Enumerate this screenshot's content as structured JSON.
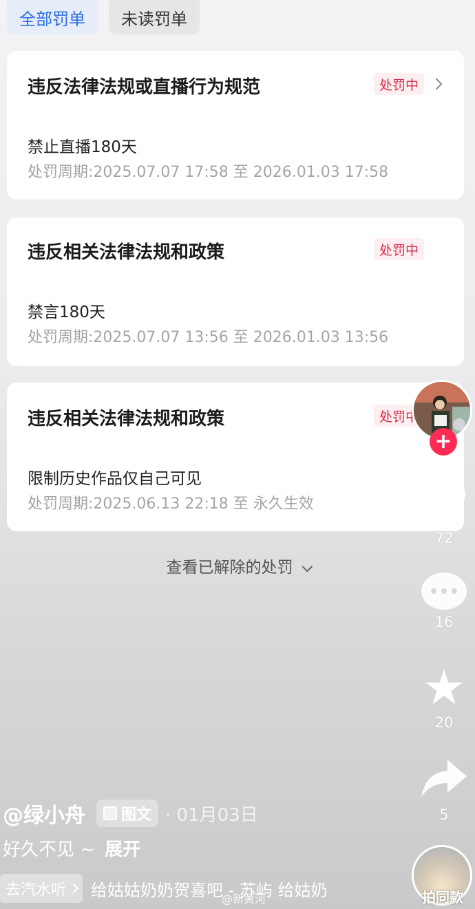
{
  "tabs": [
    {
      "label": "全部罚单",
      "active": true
    },
    {
      "label": "未读罚单",
      "active": false
    }
  ],
  "penalties": [
    {
      "title": "违反法律法规或直播行为规范",
      "status": "处罚中",
      "action": "禁止直播180天",
      "period": "处罚周期:2025.07.07 17:58 至 2026.01.03 17:58"
    },
    {
      "title": "违反相关法律法规和政策",
      "status": "处罚中",
      "action": "禁言180天",
      "period": "处罚周期:2025.07.07 13:56 至 2026.01.03 13:56"
    },
    {
      "title": "违反相关法律法规和政策",
      "status": "处罚中",
      "action": "限制历史作品仅自己可见",
      "period": "处罚周期:2025.06.13 22:18 至 永久生效"
    }
  ],
  "view_removed_label": "查看已解除的处罚",
  "rail": {
    "plus": "+",
    "likes": "72",
    "comments": "16",
    "favorites": "20",
    "shares": "5",
    "same_style_label": "拍同款"
  },
  "post": {
    "author": "@绿小舟",
    "type_label": "图文",
    "date": "· 01月03日",
    "caption": "好久不见 ~",
    "expand_label": "展开",
    "music_chip": "去汽水听",
    "music_title": "给姑姑奶奶贺喜吧 - 苏屿    给姑奶",
    "watermark": "@新黄河"
  },
  "colors": {
    "accent_blue": "#2b6de6",
    "badge_red": "#d3304a",
    "plus_red": "#fe2c55"
  }
}
